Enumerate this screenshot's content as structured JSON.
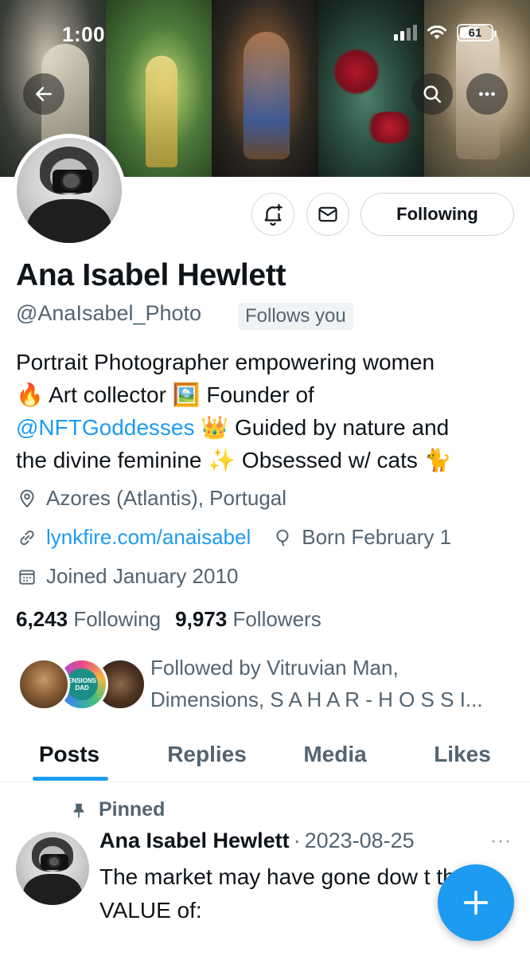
{
  "status_bar": {
    "time": "1:00",
    "battery": "61"
  },
  "banner": {
    "panels": [
      "photo-1",
      "photo-2",
      "photo-3",
      "photo-4",
      "photo-5"
    ]
  },
  "header_buttons": {
    "back_icon": "arrow-left-icon",
    "search_icon": "search-icon",
    "more_icon": "more-horizontal-icon"
  },
  "profile": {
    "display_name": "Ana Isabel Hewlett",
    "handle": "@AnaIsabel_Photo",
    "follows_you": "Follows you",
    "bio": {
      "line1": "Portrait Photographer empowering women",
      "emoji_fire": "🔥",
      "art_collector": "Art collector",
      "emoji_picture": "🖼️",
      "founder_of": "Founder of",
      "mention": "@NFTGoddesses",
      "emoji_crown": "👑",
      "guided": "Guided by nature and",
      "line4": "the divine feminine",
      "emoji_sparkles": "✨",
      "obsessed": "Obsessed w/ cats",
      "emoji_cat": "🐈"
    },
    "location": "Azores (Atlantis), Portugal",
    "website": "lynkfire.com/anaisabel",
    "born": "Born February 1",
    "joined": "Joined January 2010",
    "following_count": "6,243",
    "following_label": "Following",
    "followers_count": "9,973",
    "followers_label": "Followers",
    "followed_by": "Followed by Vitruvian Man, Dimensions, S A H A R - H O S S I...",
    "facepile_avatar2_text": "ENSIONS DAD"
  },
  "actions": {
    "notify_icon": "bell-plus-icon",
    "message_icon": "mail-icon",
    "following_label": "Following"
  },
  "tabs": [
    {
      "label": "Posts",
      "active": true
    },
    {
      "label": "Replies",
      "active": false
    },
    {
      "label": "Media",
      "active": false
    },
    {
      "label": "Likes",
      "active": false
    }
  ],
  "pinned_post": {
    "pinned_label": "Pinned",
    "author": "Ana Isabel Hewlett",
    "date": "2023-08-25",
    "text": "The market may have gone dow     t the VALUE of:",
    "more": "···"
  },
  "fab": {
    "icon": "plus-icon"
  },
  "colors": {
    "accent": "#1d9bf0",
    "text_primary": "#0f1419",
    "text_secondary": "#536471",
    "border": "#cfd9de"
  }
}
